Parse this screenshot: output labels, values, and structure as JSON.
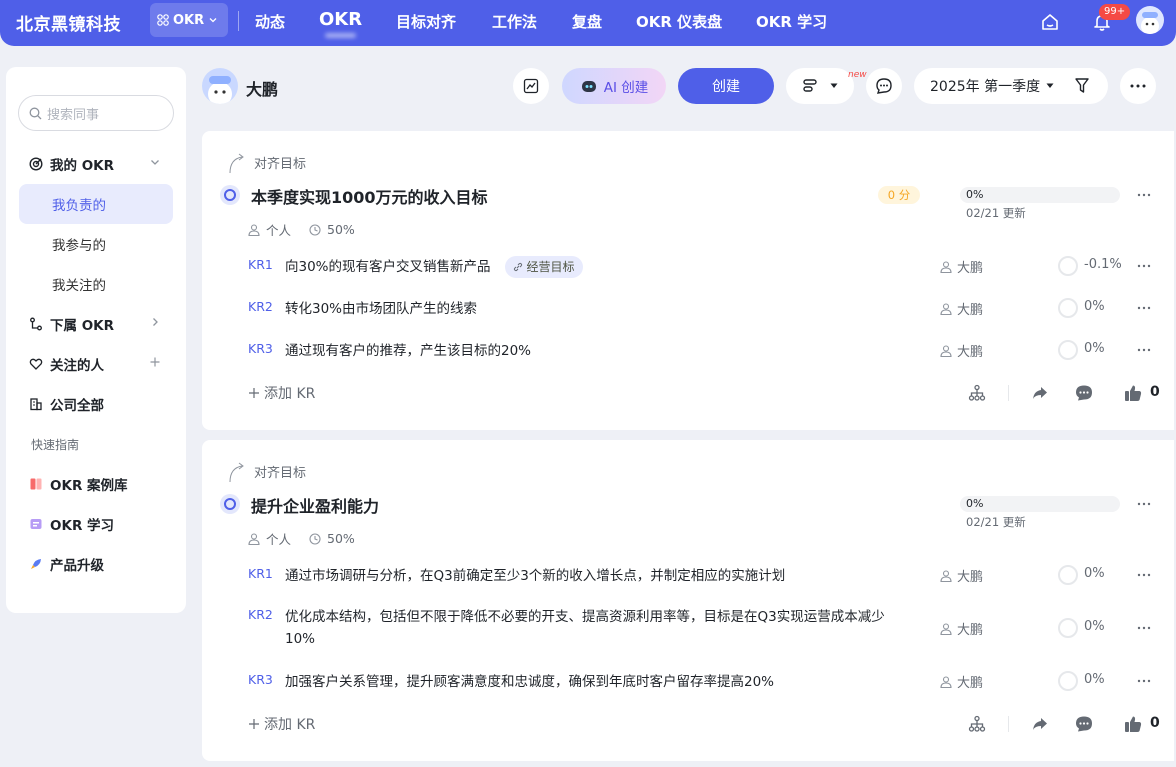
{
  "topbar": {
    "company": "北京黑镜科技",
    "app_switch": "OKR",
    "nav": [
      "动态",
      "OKR",
      "目标对齐",
      "工作法",
      "复盘",
      "OKR 仪表盘",
      "OKR 学习"
    ],
    "notification_badge": "99+"
  },
  "sidebar": {
    "search_placeholder": "搜索同事",
    "my_okr": "我的 OKR",
    "items": [
      "我负责的",
      "我参与的",
      "我关注的"
    ],
    "sub_okr": "下属 OKR",
    "followed_people": "关注的人",
    "company_all": "公司全部",
    "quick_guide": "快速指南",
    "guide_items": [
      "OKR 案例库",
      "OKR 学习",
      "产品升级"
    ]
  },
  "subbar": {
    "user_name": "大鹏",
    "ai_create": "AI 创建",
    "create": "创建",
    "new_tag": "new",
    "period": "2025年 第一季度"
  },
  "objectives": [
    {
      "align_label": "对齐目标",
      "title": "本季度实现1000万元的收入目标",
      "score": "0 分",
      "progress": "0%",
      "updated": "02/21 更新",
      "visibility": "个人",
      "weight": "50%",
      "krs": [
        {
          "label": "KR1",
          "text": "向30%的现有客户交叉销售新产品",
          "tag": "经营目标",
          "owner": "大鹏",
          "progress": "-0.1%"
        },
        {
          "label": "KR2",
          "text": "转化30%由市场团队产生的线索",
          "owner": "大鹏",
          "progress": "0%"
        },
        {
          "label": "KR3",
          "text": "通过现有客户的推荐，产生该目标的20%",
          "owner": "大鹏",
          "progress": "0%"
        }
      ],
      "add_kr": "添加 KR",
      "likes": "0"
    },
    {
      "align_label": "对齐目标",
      "title": "提升企业盈利能力",
      "progress": "0%",
      "updated": "02/21 更新",
      "visibility": "个人",
      "weight": "50%",
      "krs": [
        {
          "label": "KR1",
          "text": "通过市场调研与分析，在Q3前确定至少3个新的收入增长点，并制定相应的实施计划",
          "owner": "大鹏",
          "progress": "0%"
        },
        {
          "label": "KR2",
          "text": "优化成本结构，包括但不限于降低不必要的开支、提高资源利用率等，目标是在Q3实现运营成本减少10%",
          "owner": "大鹏",
          "progress": "0%"
        },
        {
          "label": "KR3",
          "text": "加强客户关系管理，提升顾客满意度和忠诚度，确保到年底时客户留存率提高20%",
          "owner": "大鹏",
          "progress": "0%"
        }
      ],
      "add_kr": "添加 KR",
      "likes": "0"
    }
  ],
  "colors": {
    "brand": "#4f5fe8",
    "score": "#f5a623",
    "badge": "#f54a45"
  }
}
